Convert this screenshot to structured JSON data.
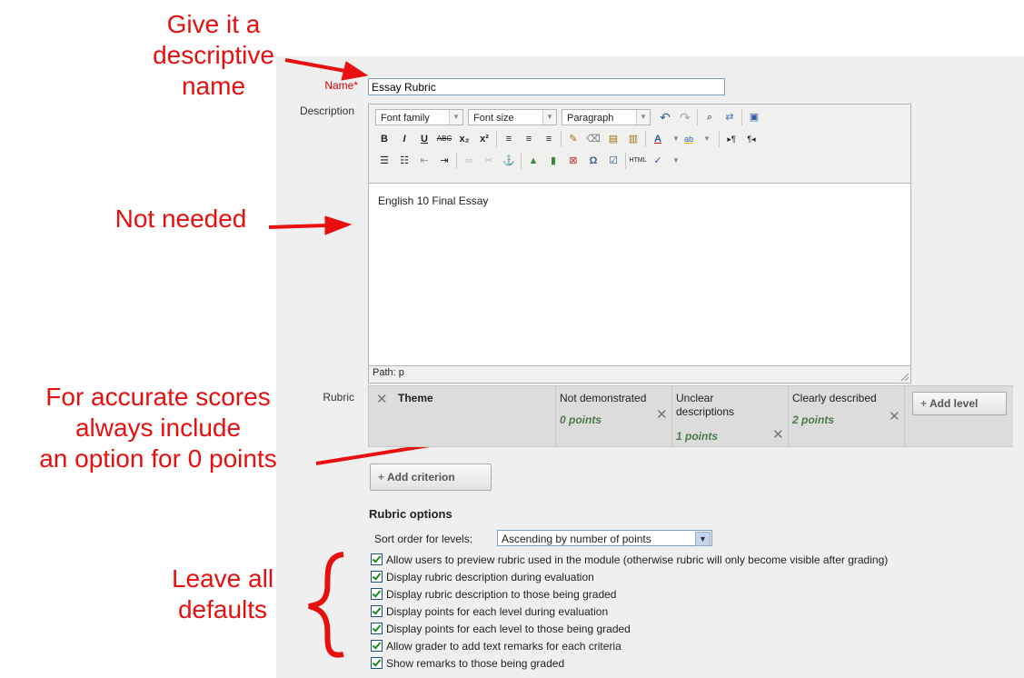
{
  "annotations": {
    "name_note": [
      "Give it a",
      "descriptive",
      "name"
    ],
    "desc_note": [
      "Not needed"
    ],
    "rubric_note": [
      "For accurate scores",
      "always include",
      "an option for 0 points"
    ],
    "options_note": [
      "Leave all",
      "defaults"
    ]
  },
  "form": {
    "name_label": "Name",
    "name_required": "*",
    "name_value": "Essay Rubric",
    "description_label": "Description",
    "rubric_label": "Rubric"
  },
  "editor": {
    "font_family": "Font family",
    "font_size": "Font size",
    "format": "Paragraph",
    "content": "English 10 Final Essay",
    "path": "Path: p"
  },
  "rubric": {
    "criterion": "Theme",
    "levels": [
      {
        "definition": "Not demonstrated",
        "points": "0 points"
      },
      {
        "definition": "Unclear descriptions",
        "points": "1 points"
      },
      {
        "definition": "Clearly described",
        "points": "2 points"
      }
    ],
    "add_level": "Add level",
    "add_criterion": "Add criterion"
  },
  "options": {
    "heading": "Rubric options",
    "sort_label": "Sort order for levels:",
    "sort_value": "Ascending by number of points",
    "items": [
      "Allow users to preview rubric used in the module (otherwise rubric will only become visible after grading)",
      "Display rubric description during evaluation",
      "Display rubric description to those being graded",
      "Display points for each level during evaluation",
      "Display points for each level to those being graded",
      "Allow grader to add text remarks for each criteria",
      "Show remarks to those being graded"
    ]
  },
  "colors": {
    "annotation": "#e8100f",
    "points": "#4a7a4a",
    "panel": "#efefef"
  }
}
